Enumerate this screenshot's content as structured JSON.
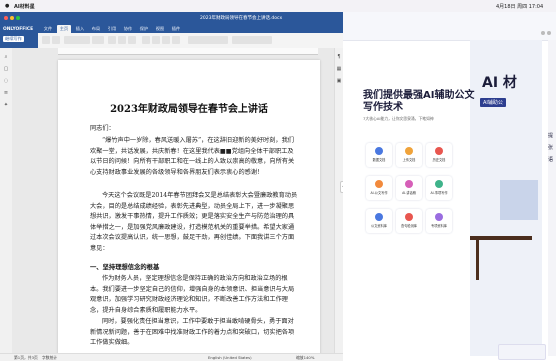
{
  "menubar": {
    "app_name": "AI材料星",
    "datetime": "4月18日 周四  17:04"
  },
  "editor": {
    "window_title": "2023年财政局领导在春节会上讲话.docx",
    "logo_text": "ONLYOFFICE",
    "logo_subtitle": "继续写作",
    "menu_tabs": [
      "文件",
      "主页",
      "插入",
      "布局",
      "引用",
      "协作",
      "保护",
      "视图",
      "插件"
    ],
    "active_tab": "主页"
  },
  "document": {
    "title": "2023年财政局领导在春节会上讲话",
    "salutation": "同志们：",
    "paragraphs": [
      "“爆竹声中一岁除，春风送暖入屠苏”，在这辞旧迎新的美好时刻，我们欢聚一堂，共话发展，共庆新春！在这里我代表■■党组向全体干部职工及以节日的问候！向所有干部职工和在一线上的人致以崇高的敬意，向所有关心支持财政事业发展的各级领导和各界朋友们表示衷心的感谢！",
      "今天这个会议既是2014年春节团拜会又是总结表彰大会暨廉政教育动员大会，目的是总结成绩经验，表彰先进典型，动员全局上下，进一步凝聚思想共识，激发干事热情，提升工作质效；更是落实安全生产与防范治理的具体举措之一，是加强党风廉政建设，打造模范机关的重要举措。希望大家通过本次会议提高认识，统一思想，鼓足干劲，再创佳绩。下面我讲三个方面意见：",
      "一、坚持理想信念的根基",
      "作为财务人员，坚定理想信念是保持正确的政治方向和政治立场的根本。我们要进一步坚定自己的信仰，增强自身的本领意识、担当意识与大局观意识，加强学习研究财政经济理论和知识，不断改善工作方法和工作理念，提升自身综合素质和履职能力水平。",
      "同时，要强化责任担当意识，工作中要敢于担当敢啃硬骨头，勇于面对新情况新问题，善于在困难中找准财政工作的着力点和突破口，切实把各项工作做实做细。"
    ]
  },
  "statusbar": {
    "page_info": "第1页，共3页",
    "word_count": "字数统计",
    "language": "English (United States)",
    "zoom": "缩放140%"
  },
  "promo": {
    "headline": "我们提供最强AI辅助公文写作技术",
    "subtitle": "7大核心AI能力，让你文思泉涌，下笔如神",
    "art_text": "AI 材",
    "art_tag": "AI辅助公",
    "side_text": "提 张 语",
    "features": [
      {
        "label": "数据文档",
        "color": "#4a78e0"
      },
      {
        "label": "上传文档",
        "color": "#f0a33a"
      },
      {
        "label": "历史文档",
        "color": "#e8564f"
      },
      {
        "label": "AI-公文写作",
        "color": "#f28a3c"
      },
      {
        "label": "AI-讲话稿",
        "color": "#d65fb8"
      },
      {
        "label": "AI-事项写作",
        "color": "#3fb38a"
      },
      {
        "label": "公文资料库",
        "color": "#4a78e0"
      },
      {
        "label": "查句检测库",
        "color": "#e8564f"
      },
      {
        "label": "专项资料库",
        "color": "#9a6de0"
      }
    ]
  },
  "colors": {
    "office_blue": "#2b579a",
    "promo_bg": "#f6f7fb"
  }
}
